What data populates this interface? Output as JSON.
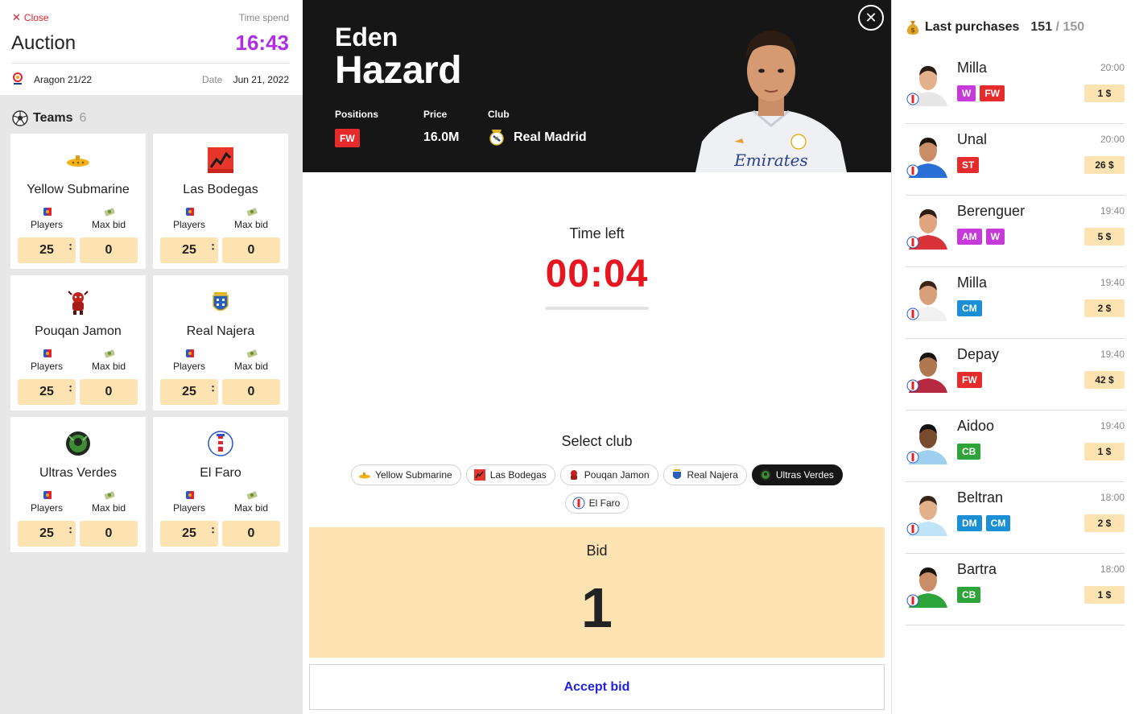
{
  "header": {
    "close_label": "Close",
    "time_spend_label": "Time spend",
    "title": "Auction",
    "time_spend": "16:43",
    "league": "Aragon 21/22",
    "date_label": "Date",
    "date": "Jun 21, 2022"
  },
  "teams": {
    "label": "Teams",
    "count": "6",
    "players_label": "Players",
    "maxbid_label": "Max bid",
    "items": [
      {
        "name": "Yellow Submarine",
        "players": "25",
        "max_bid": "0",
        "logo": "yellow-submarine-logo"
      },
      {
        "name": "Las Bodegas",
        "players": "25",
        "max_bid": "0",
        "logo": "las-bodegas-logo"
      },
      {
        "name": "Pouqan Jamon",
        "players": "25",
        "max_bid": "0",
        "logo": "pouqan-jamon-logo"
      },
      {
        "name": "Real Najera",
        "players": "25",
        "max_bid": "0",
        "logo": "real-najera-logo"
      },
      {
        "name": "Ultras Verdes",
        "players": "25",
        "max_bid": "0",
        "logo": "ultras-verdes-logo"
      },
      {
        "name": "El Faro",
        "players": "25",
        "max_bid": "0",
        "logo": "el-faro-logo"
      }
    ]
  },
  "player": {
    "first_name": "Eden",
    "last_name": "Hazard",
    "positions_label": "Positions",
    "position": "FW",
    "price_label": "Price",
    "price": "16.0M",
    "club_label": "Club",
    "club": "Real Madrid"
  },
  "timer": {
    "label": "Time left",
    "value": "00:04"
  },
  "select_club": {
    "label": "Select club",
    "clubs": [
      "Yellow Submarine",
      "Las Bodegas",
      "Pouqan Jamon",
      "Real Najera",
      "Ultras Verdes",
      "El Faro"
    ],
    "selected": "Ultras Verdes"
  },
  "bid": {
    "label": "Bid",
    "value": "1",
    "accept_label": "Accept bid"
  },
  "last_purchases": {
    "label": "Last purchases",
    "count": "151",
    "total": "150",
    "items": [
      {
        "name": "Milla",
        "time": "20:00",
        "price": "1 $",
        "positions": [
          "W",
          "FW"
        ]
      },
      {
        "name": "Unal",
        "time": "20:00",
        "price": "26 $",
        "positions": [
          "ST"
        ]
      },
      {
        "name": "Berenguer",
        "time": "19:40",
        "price": "5 $",
        "positions": [
          "AM",
          "W"
        ]
      },
      {
        "name": "Milla",
        "time": "19:40",
        "price": "2 $",
        "positions": [
          "CM"
        ]
      },
      {
        "name": "Depay",
        "time": "19:40",
        "price": "42 $",
        "positions": [
          "FW"
        ]
      },
      {
        "name": "Aidoo",
        "time": "19:40",
        "price": "1 $",
        "positions": [
          "CB"
        ]
      },
      {
        "name": "Beltran",
        "time": "18:00",
        "price": "2 $",
        "positions": [
          "DM",
          "CM"
        ]
      },
      {
        "name": "Bartra",
        "time": "18:00",
        "price": "1 $",
        "positions": [
          "CB"
        ]
      }
    ]
  },
  "colors": {
    "accent_purple": "#b02ee0",
    "timer_red": "#e5161f",
    "accept_blue": "#1f1fe6",
    "bid_bg": "#fde3b2",
    "hero_bg": "#161616",
    "pos_FW": "#e52b2b",
    "pos_ST": "#e52b2b",
    "pos_W": "#c63ad9",
    "pos_AM": "#c63ad9",
    "pos_CM": "#1a8fd6",
    "pos_DM": "#1a8fd6",
    "pos_CB": "#2ea33a"
  }
}
